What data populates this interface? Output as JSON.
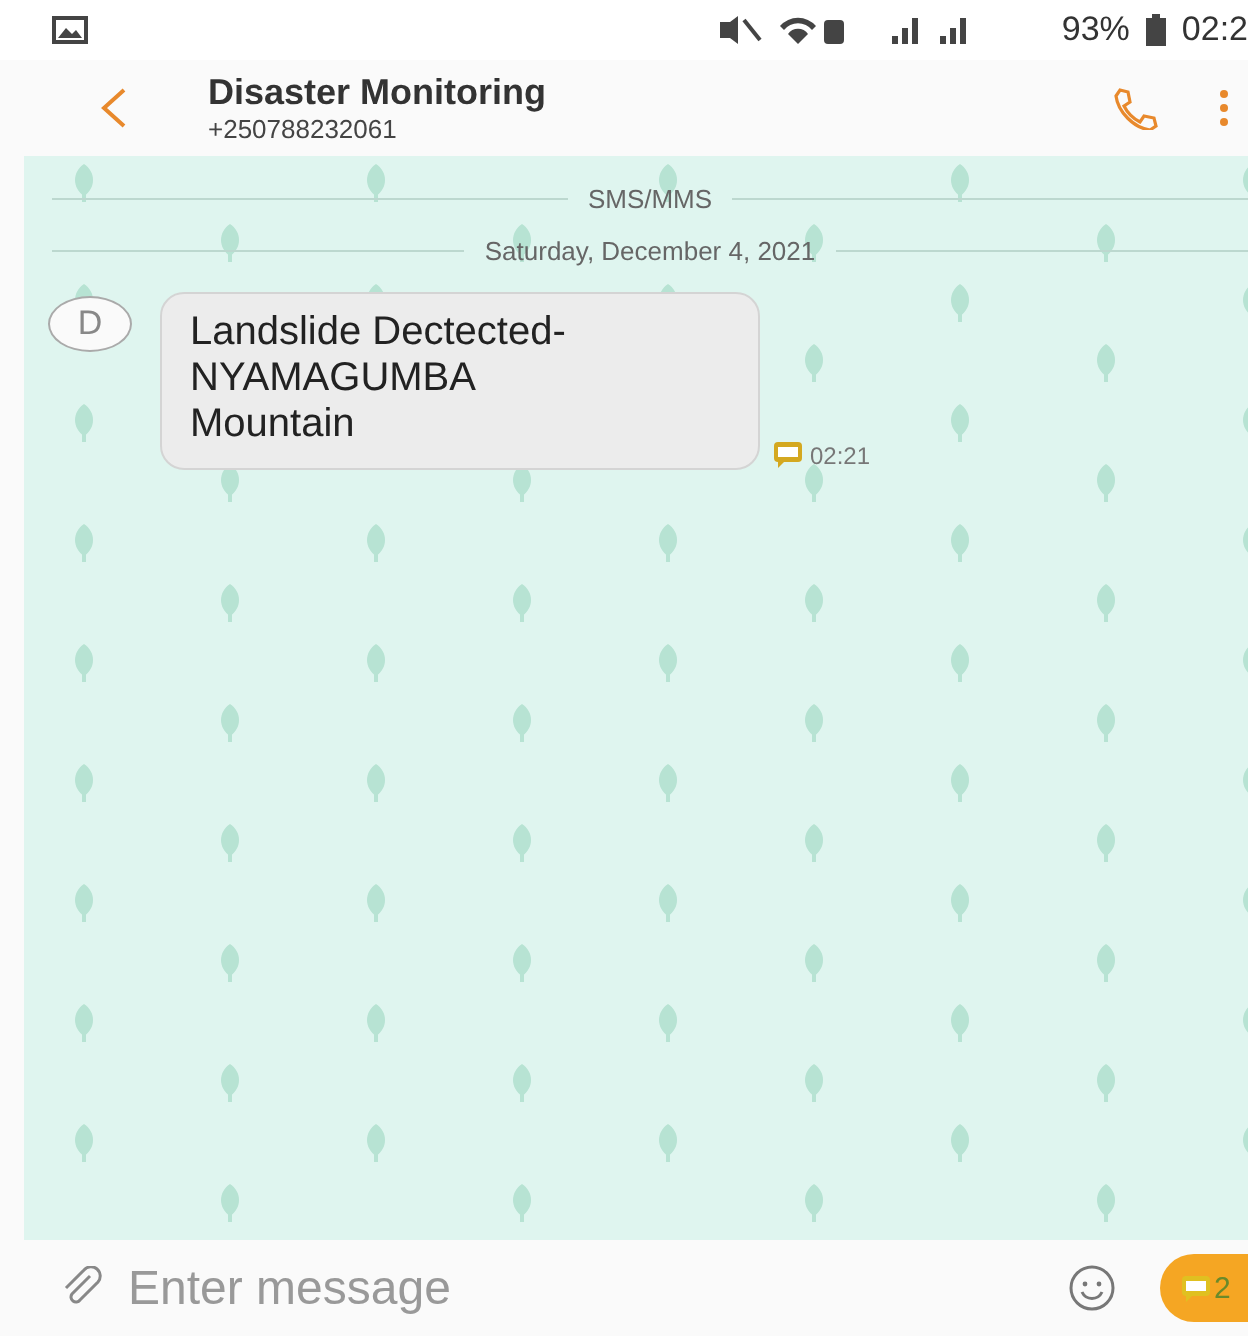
{
  "status_bar": {
    "battery": "93%",
    "time": "02:2"
  },
  "header": {
    "title": "Disaster Monitoring",
    "phone": "+250788232061"
  },
  "conversation": {
    "channel": "SMS/MMS",
    "date": "Saturday, December 4, 2021",
    "messages": [
      {
        "avatar": "D",
        "text": "Landslide Dectected-NYAMAGUMBA Mountain",
        "time": "02:21"
      }
    ]
  },
  "composer": {
    "placeholder": "Enter message",
    "send_count": "2"
  }
}
